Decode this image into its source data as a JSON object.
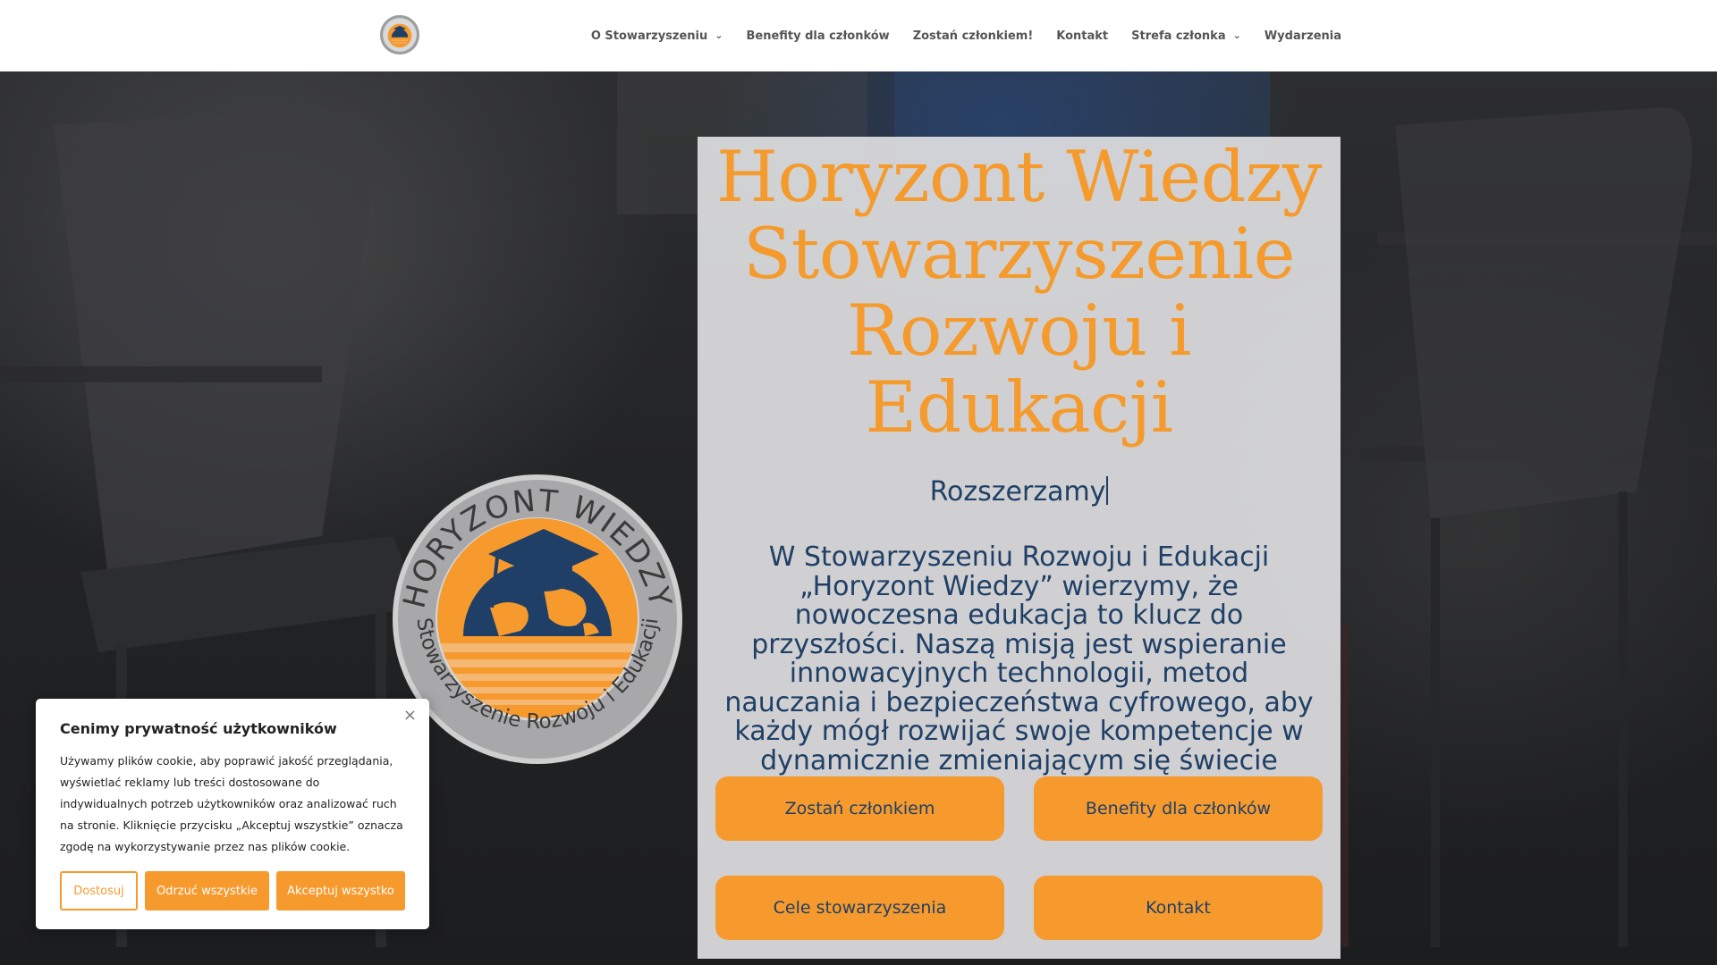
{
  "colors": {
    "accent": "#f69a2e",
    "title_orange": "#f59a2c",
    "navy": "#1f3f66",
    "panel": "#dedee0"
  },
  "logo": {
    "arc_top": "HORYZONT WIEDZY",
    "arc_bottom": "Stowarzyszenie Rozwoju i Edukacji",
    "icons": [
      "graduation-cap-icon",
      "globe-icon",
      "sea-waves-icon"
    ]
  },
  "nav": {
    "items": [
      {
        "label": "O Stowarzyszeniu",
        "has_dropdown": true
      },
      {
        "label": "Benefity dla członków",
        "has_dropdown": false
      },
      {
        "label": "Zostań członkiem!",
        "has_dropdown": false
      },
      {
        "label": "Kontakt",
        "has_dropdown": false
      },
      {
        "label": "Strefa członka",
        "has_dropdown": true
      },
      {
        "label": "Wydarzenia",
        "has_dropdown": false
      }
    ],
    "dropdown_icon": "chevron-down-icon"
  },
  "hero": {
    "title_lines": [
      "Horyzont Wiedzy",
      "Stowarzyszenie",
      "Rozwoju i",
      "Edukacji"
    ],
    "typed_text": "Rozszerzamy",
    "mission": "W Stowarzyszeniu Rozwoju i Edukacji „Horyzont Wiedzy” wierzymy, że nowoczesna edukacja to klucz do przyszłości. Naszą misją jest wspieranie innowacyjnych technologii, metod nauczania i bezpieczeństwa cyfrowego, aby każdy mógł rozwijać swoje kompetencje w dynamicznie zmieniającym się świecie",
    "buttons": [
      "Zostań członkiem",
      "Benefity dla członków",
      "Cele stowarzyszenia",
      "Kontakt"
    ]
  },
  "cookie": {
    "title": "Cenimy prywatność użytkowników",
    "text": "Używamy plików cookie, aby poprawić jakość przeglądania, wyświetlać reklamy lub treści dostosowane do indywidualnych potrzeb użytkowników oraz analizować ruch na stronie. Kliknięcie przycisku „Akceptuj wszystkie” oznacza zgodę na wykorzystywanie przez nas plików cookie.",
    "buttons": {
      "customize": "Dostosuj",
      "reject": "Odrzuć wszystkie",
      "accept": "Akceptuj wszystko"
    },
    "close_icon": "close-icon"
  }
}
